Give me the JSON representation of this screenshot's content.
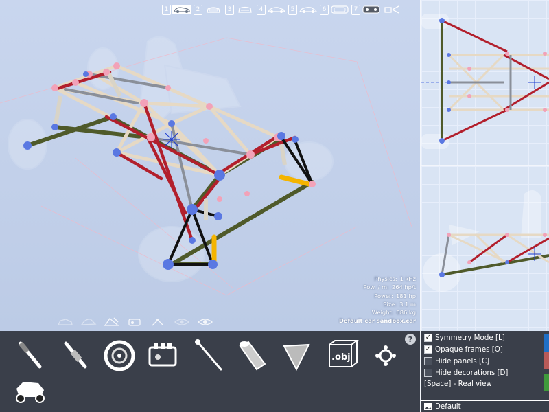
{
  "views": [
    {
      "num": "1",
      "icon": "car-top-view-icon",
      "active": true
    },
    {
      "num": "2",
      "icon": "car-front-view-icon",
      "active": false
    },
    {
      "num": "3",
      "icon": "car-rear-view-icon",
      "active": false
    },
    {
      "num": "4",
      "icon": "car-side-view-icon",
      "active": false
    },
    {
      "num": "5",
      "icon": "car-side-perspective-icon",
      "active": false
    },
    {
      "num": "6",
      "icon": "car-outline-view-icon",
      "active": false
    },
    {
      "num": "7",
      "icon": "car-dark-view-icon",
      "active": false
    }
  ],
  "stats": {
    "physics_label": "Physics:",
    "physics_value": "1 kHz",
    "pow_label": "Pow. / m:",
    "pow_value": "264 hp/t",
    "power_label": "Power:",
    "power_value": "181 hp",
    "size_label": "Size:",
    "size_value": "3.1 m",
    "weight_label": "Weight:",
    "weight_value": "686 kg",
    "file_name": "Default car sandbox.car"
  },
  "tools": [
    "bolt-tool-icon",
    "spring-tool-icon",
    "wheel-tool-icon",
    "engine-tool-icon",
    "rod-tool-icon",
    "tube-tool-icon",
    "panel-tool-icon",
    "obj-import-icon",
    "joint-tool-icon",
    "rc-car-tool-icon"
  ],
  "obj_label": ".obj",
  "help_label": "?",
  "options": {
    "symmetry": "Symmetry Mode [L]",
    "opaque": "Opaque frames [O]",
    "hide_panels": "Hide panels [C]",
    "hide_decorations": "Hide decorations [D]",
    "space": "[Space] - Real view"
  },
  "check_mark": "✓",
  "preset_name": "Default",
  "colors": {
    "accent_blue": "#1f6fc6",
    "accent_red": "#b85a58",
    "accent_green": "#3f9a3b",
    "bar_bg": "#3a3f4a"
  }
}
